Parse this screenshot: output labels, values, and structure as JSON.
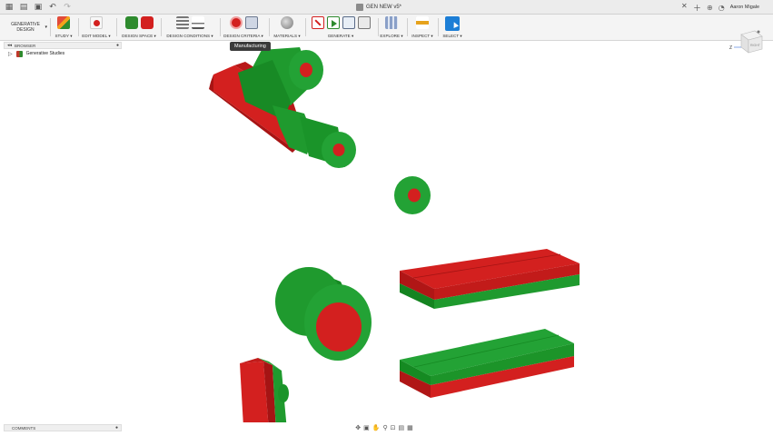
{
  "window": {
    "tab_title": "GEN NEW v5*",
    "user_name": "Aaron Migale"
  },
  "toolbar": {
    "workspace_line1": "GENERATIVE",
    "workspace_line2": "DESIGN",
    "groups": [
      {
        "label": "STUDY ▾"
      },
      {
        "label": "EDIT MODEL ▾"
      },
      {
        "label": "DESIGN SPACE ▾"
      },
      {
        "label": "DESIGN CONDITIONS ▾"
      },
      {
        "label": "DESIGN CRITERIA ▾"
      },
      {
        "label": "MATERIALS ▾"
      },
      {
        "label": "GENERATE ▾"
      },
      {
        "label": "EXPLORE ▾"
      },
      {
        "label": "INSPECT ▾"
      },
      {
        "label": "SELECT ▾"
      }
    ]
  },
  "tooltip": {
    "text": "Manufacturing"
  },
  "browser": {
    "header": "BROWSER",
    "items": [
      {
        "label": "Generative Studies"
      }
    ]
  },
  "comments": {
    "header": "COMMENTS"
  },
  "viewcube": {
    "face_label": "RIGHT",
    "axis_z": "Z"
  },
  "colors": {
    "preserve_green": "#1f9a2e",
    "obstacle_red": "#d3201f",
    "select_blue": "#1c7ed6"
  }
}
